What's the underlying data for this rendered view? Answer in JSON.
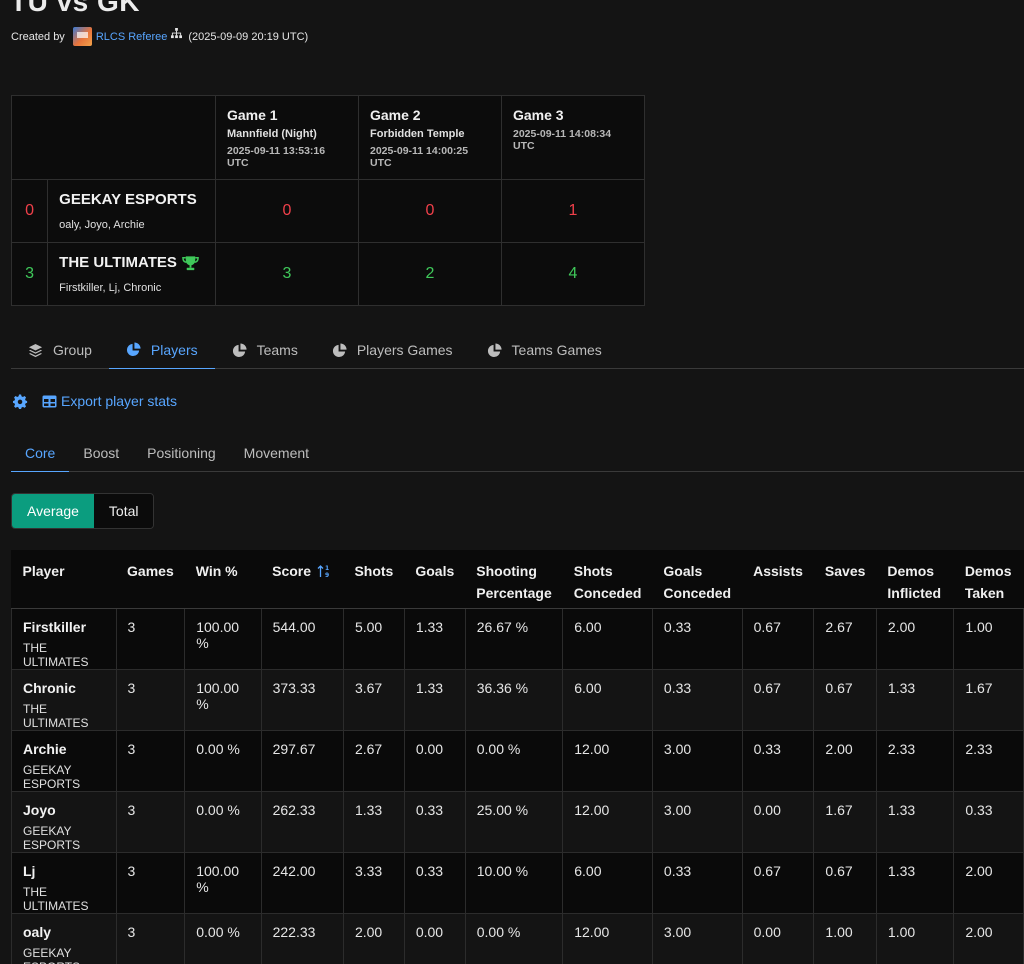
{
  "match": {
    "title": "TU vs GK",
    "created_by_label": "Created by",
    "creator": "RLCS Referee",
    "created_at": "(2025-09-09 20:19 UTC)"
  },
  "series": {
    "games": [
      {
        "name": "Game 1",
        "map": "Mannfield (Night)",
        "time": "2025-09-11 13:53:16 UTC"
      },
      {
        "name": "Game 2",
        "map": "Forbidden Temple",
        "time": "2025-09-11 14:00:25 UTC"
      },
      {
        "name": "Game 3",
        "map": "",
        "time": "2025-09-11 14:08:34 UTC"
      }
    ],
    "teams": [
      {
        "total": "0",
        "name": "GEEKAY ESPORTS",
        "players": "oaly, Joyo, Archie",
        "scores": [
          "0",
          "0",
          "1"
        ],
        "winner": false
      },
      {
        "total": "3",
        "name": "THE ULTIMATES",
        "players": "Firstkiller, Lj, Chronic",
        "scores": [
          "3",
          "2",
          "4"
        ],
        "winner": true
      }
    ]
  },
  "tabs": [
    "Group",
    "Players",
    "Teams",
    "Players Games",
    "Teams Games"
  ],
  "active_tab": "Players",
  "tools": {
    "export_label": "Export player stats"
  },
  "subtabs": [
    "Core",
    "Boost",
    "Positioning",
    "Movement"
  ],
  "active_subtab": "Core",
  "toggle": {
    "options": [
      "Average",
      "Total"
    ],
    "active": "Average"
  },
  "stats": {
    "columns": [
      {
        "line1": "Player",
        "line2": ""
      },
      {
        "line1": "Games",
        "line2": ""
      },
      {
        "line1": "Win %",
        "line2": ""
      },
      {
        "line1": "Score",
        "line2": ""
      },
      {
        "line1": "Shots",
        "line2": ""
      },
      {
        "line1": "Goals",
        "line2": ""
      },
      {
        "line1": "Shooting",
        "line2": "Percentage"
      },
      {
        "line1": "Shots",
        "line2": "Conceded"
      },
      {
        "line1": "Goals",
        "line2": "Conceded"
      },
      {
        "line1": "Assists",
        "line2": ""
      },
      {
        "line1": "Saves",
        "line2": ""
      },
      {
        "line1": "Demos",
        "line2": "Inflicted"
      },
      {
        "line1": "Demos",
        "line2": "Taken"
      }
    ],
    "rows": [
      {
        "player": "Firstkiller",
        "team": "THE ULTIMATES",
        "values": [
          "3",
          "100.00 %",
          "544.00",
          "5.00",
          "1.33",
          "26.67 %",
          "6.00",
          "0.33",
          "0.67",
          "2.67",
          "2.00",
          "1.00"
        ]
      },
      {
        "player": "Chronic",
        "team": "THE ULTIMATES",
        "values": [
          "3",
          "100.00 %",
          "373.33",
          "3.67",
          "1.33",
          "36.36 %",
          "6.00",
          "0.33",
          "0.67",
          "0.67",
          "1.33",
          "1.67"
        ]
      },
      {
        "player": "Archie",
        "team": "GEEKAY ESPORTS",
        "values": [
          "3",
          "0.00 %",
          "297.67",
          "2.67",
          "0.00",
          "0.00 %",
          "12.00",
          "3.00",
          "0.33",
          "2.00",
          "2.33",
          "2.33"
        ]
      },
      {
        "player": "Joyo",
        "team": "GEEKAY ESPORTS",
        "values": [
          "3",
          "0.00 %",
          "262.33",
          "1.33",
          "0.33",
          "25.00 %",
          "12.00",
          "3.00",
          "0.00",
          "1.67",
          "1.33",
          "0.33"
        ]
      },
      {
        "player": "Lj",
        "team": "THE ULTIMATES",
        "values": [
          "3",
          "100.00 %",
          "242.00",
          "3.33",
          "0.33",
          "10.00 %",
          "6.00",
          "0.33",
          "0.67",
          "0.67",
          "1.33",
          "2.00"
        ]
      },
      {
        "player": "oaly",
        "team": "GEEKAY ESPORTS",
        "values": [
          "3",
          "0.00 %",
          "222.33",
          "2.00",
          "0.00",
          "0.00 %",
          "12.00",
          "3.00",
          "0.00",
          "1.00",
          "1.00",
          "2.00"
        ]
      }
    ]
  },
  "colors": {
    "accent": "#58a6ff",
    "win": "#3fc95a",
    "loss": "#f0404a",
    "toggle_active": "#0b9d7f"
  }
}
